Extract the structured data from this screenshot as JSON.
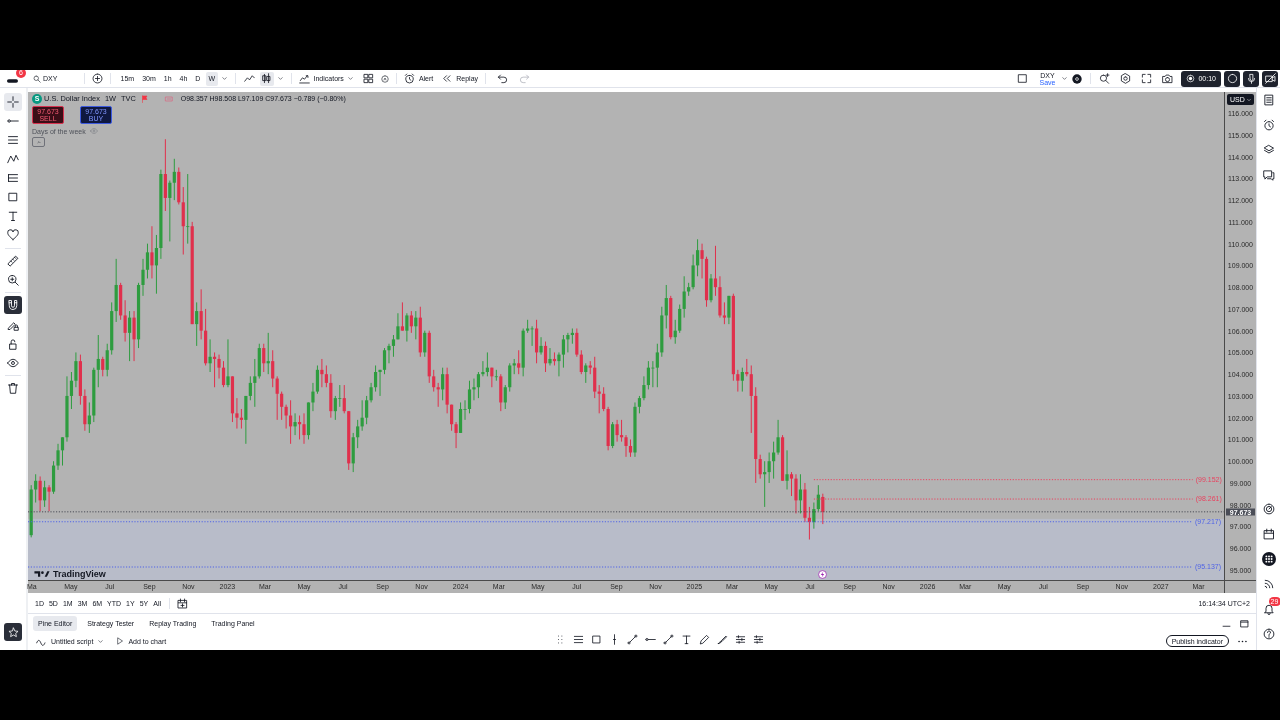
{
  "toolbar": {
    "notification_count": "6",
    "symbol": "DXY",
    "intervals": [
      {
        "label": "15m",
        "selected": false
      },
      {
        "label": "30m",
        "selected": false
      },
      {
        "label": "1h",
        "selected": false
      },
      {
        "label": "4h",
        "selected": false
      },
      {
        "label": "D",
        "selected": false
      },
      {
        "label": "W",
        "selected": true
      }
    ],
    "chart_types": [
      {
        "kind": "line",
        "selected": false
      },
      {
        "kind": "candles",
        "selected": true
      }
    ],
    "indicators_label": "Indicators",
    "alert_label": "Alert",
    "replay_label": "Replay",
    "history": [
      {
        "kind": "undo",
        "disabled": false
      },
      {
        "kind": "redo",
        "disabled": true
      }
    ],
    "layout": {
      "name": "DXY",
      "status": "Save"
    },
    "recorder_time": "00:10"
  },
  "left_toolbar": {
    "drawing_tools": [
      {
        "kind": "crosshair",
        "selected": true
      },
      {
        "kind": "trend-line",
        "selected": false
      },
      {
        "kind": "parallel-lines",
        "selected": false
      },
      {
        "kind": "pattern",
        "selected": false
      },
      {
        "kind": "fib",
        "selected": false
      },
      {
        "kind": "rectangle",
        "selected": false
      },
      {
        "kind": "text",
        "selected": false
      },
      {
        "kind": "heart",
        "selected": false
      }
    ],
    "measure_tools": [
      {
        "kind": "ruler",
        "selected": false
      },
      {
        "kind": "zoom",
        "selected": false
      }
    ],
    "magnet": {
      "on": true
    }
  },
  "chart": {
    "legend": {
      "logo_letter": "S",
      "symbol_name": "U.S. Dollar Index",
      "interval": "1W",
      "exchange": "TVC",
      "values": "O98.357 H98.508 L97.109 C97.673 −0.789 (−0.80%)"
    },
    "trade_buttons": [
      {
        "kind": "sell",
        "price": "97.673",
        "label": "SELL"
      },
      {
        "kind": "buy",
        "price": "97.673",
        "label": "BUY"
      }
    ],
    "indicator": "Days of the week",
    "logo": "TradingView",
    "currency": "USD",
    "last_price": "97.673",
    "chart_data": [
      {
        "type": "candlestick",
        "xlim": [
          "2022-02-23",
          "2027-05-30"
        ],
        "ylim": [
          94.54,
          116.97
        ],
        "x": [
          "2022-02-28",
          "2022-03-07",
          "2022-03-14",
          "2022-03-21",
          "2022-03-28",
          "2022-04-04",
          "2022-04-11",
          "2022-04-18",
          "2022-04-25",
          "2022-05-02",
          "2022-05-09",
          "2022-05-16",
          "2022-05-23",
          "2022-05-30",
          "2022-06-06",
          "2022-06-13",
          "2022-06-20",
          "2022-06-27",
          "2022-07-04",
          "2022-07-11",
          "2022-07-18",
          "2022-07-25",
          "2022-08-01",
          "2022-08-08",
          "2022-08-15",
          "2022-08-22",
          "2022-08-29",
          "2022-09-05",
          "2022-09-12",
          "2022-09-19",
          "2022-09-26",
          "2022-10-03",
          "2022-10-10",
          "2022-10-17",
          "2022-10-24",
          "2022-10-31",
          "2022-11-07",
          "2022-11-14",
          "2022-11-21",
          "2022-11-28",
          "2022-12-05",
          "2022-12-12",
          "2022-12-19",
          "2022-12-26",
          "2023-01-02",
          "2023-01-09",
          "2023-01-16",
          "2023-01-23",
          "2023-01-30",
          "2023-02-06",
          "2023-02-13",
          "2023-02-20",
          "2023-02-27",
          "2023-03-06",
          "2023-03-13",
          "2023-03-20",
          "2023-03-27",
          "2023-04-03",
          "2023-04-10",
          "2023-04-17",
          "2023-04-24",
          "2023-05-01",
          "2023-05-08",
          "2023-05-15",
          "2023-05-22",
          "2023-05-29",
          "2023-06-05",
          "2023-06-12",
          "2023-06-19",
          "2023-06-26",
          "2023-07-03",
          "2023-07-10",
          "2023-07-17",
          "2023-07-24",
          "2023-07-31",
          "2023-08-07",
          "2023-08-14",
          "2023-08-21",
          "2023-08-28",
          "2023-09-04",
          "2023-09-11",
          "2023-09-18",
          "2023-09-25",
          "2023-10-02",
          "2023-10-09",
          "2023-10-16",
          "2023-10-23",
          "2023-10-30",
          "2023-11-06",
          "2023-11-13",
          "2023-11-20",
          "2023-11-27",
          "2023-12-04",
          "2023-12-11",
          "2023-12-18",
          "2023-12-25",
          "2024-01-01",
          "2024-01-08",
          "2024-01-15",
          "2024-01-22",
          "2024-01-29",
          "2024-02-05",
          "2024-02-12",
          "2024-02-19",
          "2024-02-26",
          "2024-03-04",
          "2024-03-11",
          "2024-03-18",
          "2024-03-25",
          "2024-04-01",
          "2024-04-08",
          "2024-04-15",
          "2024-04-22",
          "2024-04-29",
          "2024-05-06",
          "2024-05-13",
          "2024-05-20",
          "2024-05-27",
          "2024-06-03",
          "2024-06-10",
          "2024-06-17",
          "2024-06-24",
          "2024-07-01",
          "2024-07-08",
          "2024-07-15",
          "2024-07-22",
          "2024-07-29",
          "2024-08-05",
          "2024-08-12",
          "2024-08-19",
          "2024-08-26",
          "2024-09-02",
          "2024-09-09",
          "2024-09-16",
          "2024-09-23",
          "2024-09-30",
          "2024-10-07",
          "2024-10-14",
          "2024-10-21",
          "2024-10-28",
          "2024-11-04",
          "2024-11-11",
          "2024-11-18",
          "2024-11-25",
          "2024-12-02",
          "2024-12-09",
          "2024-12-16",
          "2024-12-23",
          "2024-12-30",
          "2025-01-06",
          "2025-01-13",
          "2025-01-20",
          "2025-01-27",
          "2025-02-03",
          "2025-02-10",
          "2025-02-17",
          "2025-02-24",
          "2025-03-03",
          "2025-03-10",
          "2025-03-17",
          "2025-03-24",
          "2025-03-31",
          "2025-04-07",
          "2025-04-14",
          "2025-04-21",
          "2025-04-28",
          "2025-05-05",
          "2025-05-12",
          "2025-05-19",
          "2025-05-26",
          "2025-06-02",
          "2025-06-09",
          "2025-06-16",
          "2025-06-23",
          "2025-06-30",
          "2025-07-07",
          "2025-07-14",
          "2025-07-21"
        ],
        "ohlc": [
          [
            96.6,
            98.9,
            96.5,
            98.7
          ],
          [
            98.7,
            99.4,
            98.1,
            99.1
          ],
          [
            99.1,
            99.3,
            97.7,
            98.2
          ],
          [
            98.2,
            99.1,
            97.9,
            98.8
          ],
          [
            98.8,
            98.9,
            97.7,
            98.6
          ],
          [
            98.6,
            100.0,
            98.5,
            99.8
          ],
          [
            99.8,
            100.8,
            99.6,
            100.5
          ],
          [
            100.5,
            101.1,
            99.8,
            101.1
          ],
          [
            101.1,
            103.9,
            100.9,
            103.0
          ],
          [
            103.0,
            104.1,
            102.4,
            103.7
          ],
          [
            103.7,
            105.0,
            103.4,
            104.6
          ],
          [
            104.6,
            104.9,
            102.6,
            103.0
          ],
          [
            103.0,
            103.3,
            101.4,
            101.7
          ],
          [
            101.7,
            102.7,
            101.3,
            102.1
          ],
          [
            102.1,
            104.3,
            101.8,
            104.2
          ],
          [
            104.2,
            105.8,
            103.4,
            104.7
          ],
          [
            104.7,
            104.8,
            103.9,
            104.2
          ],
          [
            104.2,
            105.4,
            103.9,
            105.1
          ],
          [
            105.1,
            107.3,
            104.9,
            106.9
          ],
          [
            106.9,
            109.3,
            106.4,
            108.1
          ],
          [
            108.1,
            108.2,
            106.5,
            106.7
          ],
          [
            106.7,
            107.4,
            105.5,
            105.9
          ],
          [
            105.9,
            106.9,
            104.6,
            106.6
          ],
          [
            106.6,
            106.9,
            104.6,
            105.6
          ],
          [
            105.6,
            108.2,
            105.2,
            108.1
          ],
          [
            108.1,
            109.3,
            107.6,
            108.8
          ],
          [
            108.8,
            110.0,
            108.4,
            109.6
          ],
          [
            109.6,
            110.8,
            108.4,
            109.0
          ],
          [
            109.0,
            110.4,
            107.7,
            109.8
          ],
          [
            109.8,
            113.4,
            109.3,
            113.2
          ],
          [
            113.2,
            114.8,
            111.5,
            112.1
          ],
          [
            112.1,
            112.9,
            110.1,
            112.8
          ],
          [
            112.8,
            113.9,
            112.0,
            113.3
          ],
          [
            113.3,
            113.5,
            111.8,
            111.9
          ],
          [
            111.9,
            112.6,
            109.5,
            110.8
          ],
          [
            110.8,
            113.2,
            110.0,
            110.8
          ],
          [
            110.8,
            111.0,
            106.3,
            106.3
          ],
          [
            106.3,
            107.3,
            105.3,
            106.9
          ],
          [
            106.9,
            107.9,
            105.6,
            106.0
          ],
          [
            106.0,
            107.0,
            104.4,
            104.5
          ],
          [
            104.5,
            105.6,
            104.1,
            104.8
          ],
          [
            104.8,
            105.0,
            103.4,
            104.7
          ],
          [
            104.7,
            104.9,
            103.8,
            104.3
          ],
          [
            104.3,
            104.6,
            103.4,
            103.5
          ],
          [
            103.5,
            105.6,
            103.4,
            103.9
          ],
          [
            103.9,
            103.9,
            101.8,
            102.2
          ],
          [
            102.2,
            102.9,
            101.5,
            102.0
          ],
          [
            102.0,
            102.4,
            101.5,
            101.9
          ],
          [
            101.9,
            103.0,
            100.8,
            103.0
          ],
          [
            103.0,
            103.9,
            102.8,
            103.6
          ],
          [
            103.6,
            104.7,
            102.5,
            103.9
          ],
          [
            103.9,
            105.4,
            103.8,
            105.2
          ],
          [
            105.2,
            105.4,
            104.1,
            104.5
          ],
          [
            104.5,
            105.9,
            104.0,
            104.6
          ],
          [
            104.6,
            105.1,
            103.4,
            103.8
          ],
          [
            103.8,
            103.9,
            101.9,
            103.1
          ],
          [
            103.1,
            103.2,
            101.9,
            102.5
          ],
          [
            102.5,
            102.6,
            101.5,
            102.1
          ],
          [
            102.1,
            102.8,
            100.8,
            101.6
          ],
          [
            101.6,
            102.2,
            101.2,
            101.8
          ],
          [
            101.8,
            102.1,
            101.0,
            101.7
          ],
          [
            101.7,
            102.2,
            100.8,
            101.2
          ],
          [
            101.2,
            102.7,
            101.0,
            102.7
          ],
          [
            102.7,
            103.6,
            102.3,
            103.2
          ],
          [
            103.2,
            104.4,
            103.1,
            104.2
          ],
          [
            104.2,
            104.7,
            103.4,
            104.0
          ],
          [
            104.0,
            104.4,
            103.4,
            103.6
          ],
          [
            103.6,
            104.0,
            102.0,
            102.3
          ],
          [
            102.3,
            103.0,
            101.9,
            102.9
          ],
          [
            102.9,
            103.5,
            102.5,
            102.9
          ],
          [
            102.9,
            103.5,
            102.2,
            102.3
          ],
          [
            102.3,
            102.3,
            99.6,
            99.9
          ],
          [
            99.9,
            101.3,
            99.5,
            101.1
          ],
          [
            101.1,
            101.9,
            100.6,
            101.6
          ],
          [
            101.6,
            102.8,
            101.4,
            102.0
          ],
          [
            102.0,
            103.0,
            101.7,
            102.8
          ],
          [
            102.8,
            103.6,
            102.7,
            103.4
          ],
          [
            103.4,
            104.4,
            103.2,
            104.1
          ],
          [
            104.1,
            104.2,
            103.0,
            104.2
          ],
          [
            104.2,
            105.2,
            104.0,
            105.1
          ],
          [
            105.1,
            105.4,
            104.5,
            105.3
          ],
          [
            105.3,
            105.8,
            104.8,
            105.6
          ],
          [
            105.6,
            106.8,
            105.6,
            106.2
          ],
          [
            106.2,
            107.3,
            106.0,
            106.0
          ],
          [
            106.0,
            106.8,
            105.5,
            106.7
          ],
          [
            106.7,
            106.9,
            105.9,
            106.2
          ],
          [
            106.2,
            106.9,
            105.6,
            106.6
          ],
          [
            106.6,
            107.1,
            104.8,
            105.0
          ],
          [
            105.0,
            106.0,
            104.8,
            105.9
          ],
          [
            105.9,
            106.0,
            103.6,
            103.9
          ],
          [
            103.9,
            104.2,
            103.2,
            103.4
          ],
          [
            103.4,
            103.6,
            102.5,
            103.3
          ],
          [
            103.3,
            104.3,
            102.8,
            104.0
          ],
          [
            104.0,
            104.3,
            102.2,
            102.6
          ],
          [
            102.6,
            102.6,
            101.4,
            101.7
          ],
          [
            101.7,
            101.8,
            100.6,
            101.3
          ],
          [
            101.3,
            102.7,
            101.3,
            102.4
          ],
          [
            102.4,
            102.8,
            101.9,
            102.4
          ],
          [
            102.4,
            103.7,
            102.2,
            103.3
          ],
          [
            103.3,
            103.8,
            102.8,
            103.4
          ],
          [
            103.4,
            104.1,
            102.9,
            104.0
          ],
          [
            104.0,
            104.6,
            103.9,
            104.1
          ],
          [
            104.1,
            105.0,
            103.9,
            104.3
          ],
          [
            104.3,
            104.3,
            103.4,
            103.9
          ],
          [
            103.9,
            104.2,
            103.7,
            103.9
          ],
          [
            103.9,
            104.0,
            102.3,
            102.7
          ],
          [
            102.7,
            103.5,
            102.4,
            103.4
          ],
          [
            103.4,
            104.5,
            103.2,
            104.4
          ],
          [
            104.4,
            104.7,
            104.0,
            104.5
          ],
          [
            104.5,
            105.1,
            104.0,
            104.3
          ],
          [
            104.3,
            106.1,
            103.9,
            106.0
          ],
          [
            106.0,
            106.5,
            105.9,
            106.1
          ],
          [
            106.1,
            106.2,
            105.3,
            106.1
          ],
          [
            106.1,
            106.5,
            104.5,
            105.0
          ],
          [
            105.0,
            105.7,
            104.9,
            105.3
          ],
          [
            105.3,
            105.5,
            104.1,
            104.5
          ],
          [
            104.5,
            105.2,
            104.4,
            104.7
          ],
          [
            104.7,
            105.0,
            104.4,
            104.6
          ],
          [
            104.6,
            105.0,
            103.9,
            104.9
          ],
          [
            104.9,
            105.8,
            104.3,
            105.6
          ],
          [
            105.6,
            105.9,
            105.0,
            105.8
          ],
          [
            105.8,
            106.1,
            105.4,
            105.9
          ],
          [
            105.9,
            106.1,
            104.8,
            104.9
          ],
          [
            104.9,
            105.1,
            104.0,
            104.1
          ],
          [
            104.1,
            104.5,
            103.6,
            104.4
          ],
          [
            104.4,
            104.6,
            104.0,
            104.3
          ],
          [
            104.3,
            104.8,
            102.9,
            103.2
          ],
          [
            103.2,
            103.5,
            102.2,
            103.1
          ],
          [
            103.1,
            103.4,
            102.3,
            102.4
          ],
          [
            102.4,
            102.5,
            100.5,
            100.7
          ],
          [
            100.7,
            101.8,
            100.6,
            101.7
          ],
          [
            101.7,
            101.9,
            100.9,
            101.2
          ],
          [
            101.2,
            101.9,
            100.9,
            101.1
          ],
          [
            101.1,
            101.2,
            100.2,
            100.7
          ],
          [
            100.7,
            101.0,
            100.2,
            100.4
          ],
          [
            100.4,
            102.7,
            100.2,
            102.5
          ],
          [
            102.5,
            103.0,
            102.2,
            102.9
          ],
          [
            102.9,
            103.9,
            102.8,
            103.5
          ],
          [
            103.5,
            104.6,
            103.3,
            104.3
          ],
          [
            104.3,
            104.6,
            103.4,
            104.3
          ],
          [
            104.3,
            105.4,
            103.4,
            105.0
          ],
          [
            105.0,
            107.1,
            104.8,
            106.7
          ],
          [
            106.7,
            108.1,
            106.1,
            107.5
          ],
          [
            107.5,
            107.6,
            105.6,
            105.7
          ],
          [
            105.7,
            106.5,
            105.4,
            106.0
          ],
          [
            106.0,
            107.2,
            105.9,
            107.0
          ],
          [
            107.0,
            108.5,
            106.6,
            107.8
          ],
          [
            107.8,
            108.2,
            107.6,
            108.0
          ],
          [
            108.0,
            109.5,
            107.9,
            109.0
          ],
          [
            109.0,
            110.2,
            108.5,
            109.7
          ],
          [
            109.7,
            110.0,
            108.4,
            109.3
          ],
          [
            109.3,
            109.4,
            107.1,
            107.4
          ],
          [
            107.4,
            108.6,
            107.3,
            108.4
          ],
          [
            108.4,
            109.9,
            107.6,
            108.0
          ],
          [
            108.0,
            108.5,
            106.6,
            106.7
          ],
          [
            106.7,
            107.3,
            106.3,
            106.6
          ],
          [
            106.6,
            107.6,
            106.3,
            107.6
          ],
          [
            107.6,
            107.7,
            103.7,
            104.0
          ],
          [
            104.0,
            104.2,
            103.2,
            103.7
          ],
          [
            103.7,
            104.3,
            103.2,
            104.1
          ],
          [
            104.1,
            104.7,
            103.9,
            104.0
          ],
          [
            104.0,
            104.4,
            101.3,
            103.0
          ],
          [
            103.0,
            103.4,
            99.0,
            100.1
          ],
          [
            100.1,
            100.3,
            99.2,
            99.4
          ],
          [
            99.4,
            100.0,
            97.9,
            99.5
          ],
          [
            99.5,
            100.4,
            99.0,
            100.0
          ],
          [
            100.0,
            100.9,
            99.2,
            100.4
          ],
          [
            100.4,
            101.9,
            100.3,
            101.1
          ],
          [
            101.1,
            101.2,
            99.1,
            99.1
          ],
          [
            99.1,
            100.5,
            98.7,
            99.4
          ],
          [
            99.4,
            99.5,
            98.4,
            99.2
          ],
          [
            99.2,
            99.4,
            97.6,
            98.2
          ],
          [
            98.2,
            99.4,
            97.6,
            98.7
          ],
          [
            98.7,
            99.0,
            97.2,
            97.4
          ],
          [
            97.4,
            97.9,
            96.4,
            97.2
          ],
          [
            97.2,
            98.1,
            96.9,
            97.8
          ],
          [
            97.8,
            98.9,
            97.7,
            98.462
          ],
          [
            98.357,
            98.508,
            97.109,
            97.673
          ]
        ],
        "series": [
          {
            "name": "(99.152)",
            "type": "line",
            "x": [
              "2025-07-07",
              "2027-02-20"
            ],
            "values": [
              99.152,
              99.152
            ],
            "color": "#e8435f",
            "line_style": "dotted"
          },
          {
            "name": "(98.261)",
            "type": "line",
            "x": [
              "2025-07-07",
              "2027-02-20"
            ],
            "values": [
              98.261,
              98.261
            ],
            "color": "#e8435f",
            "line_style": "dotted"
          }
        ],
        "xticks": [
          {
            "value": "2022-03-01",
            "label": "Ma"
          },
          {
            "value": "2022-05-01",
            "label": "May"
          },
          {
            "value": "2022-07-01",
            "label": "Jul"
          },
          {
            "value": "2022-09-01",
            "label": "Sep"
          },
          {
            "value": "2022-11-01",
            "label": "Nov"
          },
          {
            "value": "2023-01-01",
            "label": "2023"
          },
          {
            "value": "2023-03-01",
            "label": "Mar"
          },
          {
            "value": "2023-05-01",
            "label": "May"
          },
          {
            "value": "2023-07-01",
            "label": "Jul"
          },
          {
            "value": "2023-09-01",
            "label": "Sep"
          },
          {
            "value": "2023-11-01",
            "label": "Nov"
          },
          {
            "value": "2024-01-01",
            "label": "2024"
          },
          {
            "value": "2024-03-01",
            "label": "Mar"
          },
          {
            "value": "2024-05-01",
            "label": "May"
          },
          {
            "value": "2024-07-01",
            "label": "Jul"
          },
          {
            "value": "2024-09-01",
            "label": "Sep"
          },
          {
            "value": "2024-11-01",
            "label": "Nov"
          },
          {
            "value": "2025-01-01",
            "label": "2025"
          },
          {
            "value": "2025-03-01",
            "label": "Mar"
          },
          {
            "value": "2025-05-01",
            "label": "May"
          },
          {
            "value": "2025-07-01",
            "label": "Jul"
          },
          {
            "value": "2025-09-01",
            "label": "Sep"
          },
          {
            "value": "2025-11-01",
            "label": "Nov"
          },
          {
            "value": "2026-01-01",
            "label": "2026"
          },
          {
            "value": "2026-03-01",
            "label": "Mar"
          },
          {
            "value": "2026-05-01",
            "label": "May"
          },
          {
            "value": "2026-07-01",
            "label": "Jul"
          },
          {
            "value": "2026-09-01",
            "label": "Sep"
          },
          {
            "value": "2026-11-01",
            "label": "Nov"
          },
          {
            "value": "2027-01-01",
            "label": "2027"
          },
          {
            "value": "2027-03-01",
            "label": "Mar"
          }
        ],
        "yticks": [
          {
            "value": 116,
            "label": "116.000"
          },
          {
            "value": 115,
            "label": "115.000"
          },
          {
            "value": 114,
            "label": "114.000"
          },
          {
            "value": 113,
            "label": "113.000"
          },
          {
            "value": 112,
            "label": "112.000"
          },
          {
            "value": 111,
            "label": "111.000"
          },
          {
            "value": 110,
            "label": "110.000"
          },
          {
            "value": 109,
            "label": "109.000"
          },
          {
            "value": 108,
            "label": "108.000"
          },
          {
            "value": 107,
            "label": "107.000"
          },
          {
            "value": 106,
            "label": "106.000"
          },
          {
            "value": 105,
            "label": "105.000"
          },
          {
            "value": 104,
            "label": "104.000"
          },
          {
            "value": 103,
            "label": "103.000"
          },
          {
            "value": 102,
            "label": "102.000"
          },
          {
            "value": 101,
            "label": "101.000"
          },
          {
            "value": 100,
            "label": "100.000"
          },
          {
            "value": 99,
            "label": "99.000"
          },
          {
            "value": 98,
            "label": "98.000"
          },
          {
            "value": 97,
            "label": "97.000"
          },
          {
            "value": 96,
            "label": "96.000"
          },
          {
            "value": 95,
            "label": "95.000"
          }
        ],
        "ref_lines": [
          {
            "axis": "y",
            "value": 97.673,
            "color": "#4a4d57",
            "line_style": "dotted"
          },
          {
            "axis": "y",
            "value": 97.217,
            "label": "(97.217)",
            "color": "#4f63e6",
            "line_style": "dotted"
          },
          {
            "axis": "y",
            "value": 95.137,
            "label": "(95.137)",
            "color": "#4f63e6",
            "line_style": "dotted"
          }
        ],
        "bands": [
          {
            "axis": "y",
            "from": 94.54,
            "to": 97.35,
            "color": "#b8bcc9"
          }
        ]
      }
    ]
  },
  "right_sidebar": {
    "notifications_badge": "29"
  },
  "range_bar": {
    "ranges": [
      "1D",
      "5D",
      "1M",
      "3M",
      "6M",
      "YTD",
      "1Y",
      "5Y",
      "All"
    ],
    "clock": "16:14:34 UTC+2"
  },
  "bottom_panel": {
    "tabs": [
      {
        "label": "Pine Editor",
        "selected": true
      },
      {
        "label": "Strategy Tester",
        "selected": false
      },
      {
        "label": "Replay Trading",
        "selected": false
      },
      {
        "label": "Trading Panel",
        "selected": false
      }
    ],
    "script_name": "Untitled script",
    "add_to_chart": "Add to chart",
    "publish": "Publish indicator"
  }
}
